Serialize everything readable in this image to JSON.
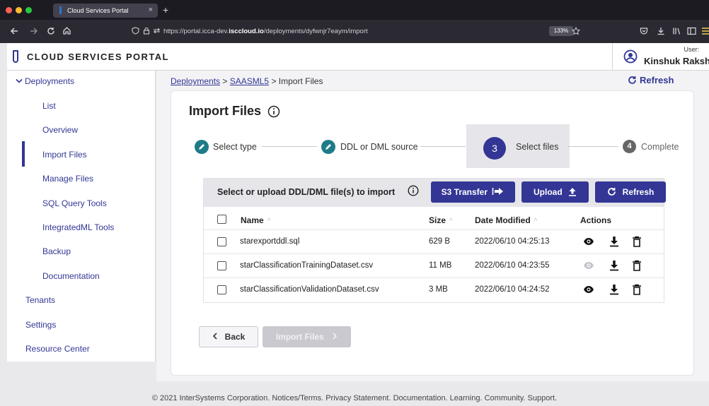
{
  "browser": {
    "tab_title": "Cloud Services Portal",
    "tab_close": "×",
    "new_tab": "+",
    "url_prefix": "https://portal.icca-dev.",
    "url_domain": "isccloud.io",
    "url_path": "/deployments/dyfwnjr7eaym/import",
    "zoom": "133%"
  },
  "app": {
    "brand": "CLOUD SERVICES PORTAL",
    "user_label": "User:",
    "user_name": "Kinshuk Rakshith"
  },
  "sidebar": {
    "section": "Deployments",
    "items": [
      "List",
      "Overview",
      "Import Files",
      "Manage Files",
      "SQL Query Tools",
      "IntegratedML Tools",
      "Backup",
      "Documentation"
    ],
    "active_item": "Import Files",
    "top_items": [
      "Tenants",
      "Settings",
      "Resource Center"
    ]
  },
  "breadcrumb": {
    "root": "Deployments",
    "sep1": ">",
    "deployment": "SAASML5",
    "sep2": ">",
    "current": "Import Files"
  },
  "header": {
    "refresh_label": "Refresh"
  },
  "page": {
    "title": "Import Files"
  },
  "stepper": {
    "steps": [
      {
        "label": "Select type",
        "state": "done"
      },
      {
        "label": "DDL or DML source",
        "state": "done"
      },
      {
        "label": "Select files",
        "state": "active",
        "number": "3"
      },
      {
        "label": "Complete",
        "state": "pending",
        "number": "4"
      }
    ]
  },
  "files_panel": {
    "title": "Select or upload DDL/DML file(s) to import",
    "s3_button": "S3 Transfer",
    "upload_button": "Upload",
    "refresh_button": "Refresh",
    "columns": [
      "Name",
      "Size",
      "Date Modified",
      "Actions"
    ],
    "rows": [
      {
        "name": "starexportddl.sql",
        "size": "629 B",
        "date": "2022/06/10 04:25:13",
        "preview_enabled": true
      },
      {
        "name": "starClassificationTrainingDataset.csv",
        "size": "11 MB",
        "date": "2022/06/10 04:23:55",
        "preview_enabled": false
      },
      {
        "name": "starClassificationValidationDataset.csv",
        "size": "3 MB",
        "date": "2022/06/10 04:24:52",
        "preview_enabled": true
      }
    ]
  },
  "actions": {
    "back": "Back",
    "import": "Import Files"
  },
  "footer": "© 2021 InterSystems Corporation. Notices/Terms. Privacy Statement. Documentation. Learning. Community. Support.",
  "colors": {
    "primary": "#333695",
    "step_done": "#1d7c88",
    "chrome_dark": "#1c1b22",
    "disabled": "#c9c9cf"
  }
}
